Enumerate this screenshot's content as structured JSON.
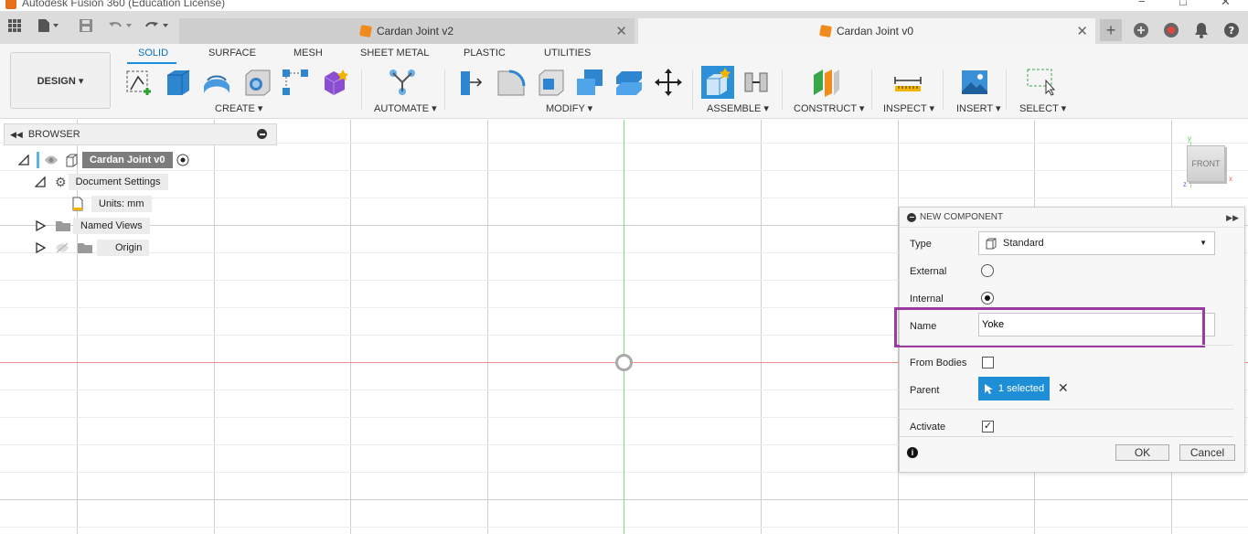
{
  "window": {
    "title": "Autodesk Fusion 360 (Education License)"
  },
  "tabs": [
    {
      "label": "Cardan Joint v2",
      "active": false
    },
    {
      "label": "Cardan Joint v0",
      "active": true
    }
  ],
  "toolbar": {
    "design_label": "DESIGN ▾",
    "ribbon_tabs": [
      "SOLID",
      "SURFACE",
      "MESH",
      "SHEET METAL",
      "PLASTIC",
      "UTILITIES"
    ],
    "groups": {
      "create": "CREATE ▾",
      "automate": "AUTOMATE ▾",
      "modify": "MODIFY ▾",
      "assemble": "ASSEMBLE ▾",
      "construct": "CONSTRUCT ▾",
      "inspect": "INSPECT ▾",
      "insert": "INSERT ▾",
      "select": "SELECT ▾"
    }
  },
  "browser": {
    "title": "BROWSER",
    "root": "Cardan Joint v0",
    "items": {
      "document_settings": "Document Settings",
      "units": "Units: mm",
      "named_views": "Named Views",
      "origin": "Origin"
    }
  },
  "viewcube": {
    "label": "FRONT"
  },
  "dialog": {
    "title": "NEW COMPONENT",
    "type_label": "Type",
    "type_value": "Standard",
    "external_label": "External",
    "internal_label": "Internal",
    "name_label": "Name",
    "name_value": "Yoke",
    "from_bodies_label": "From Bodies",
    "parent_label": "Parent",
    "parent_value": "1 selected",
    "activate_label": "Activate",
    "ok_label": "OK",
    "cancel_label": "Cancel"
  },
  "colors": {
    "accent": "#1e8fd6",
    "highlight": "#9a3ba0",
    "x_axis": "#f08a8a",
    "y_axis": "#7fe07f"
  }
}
